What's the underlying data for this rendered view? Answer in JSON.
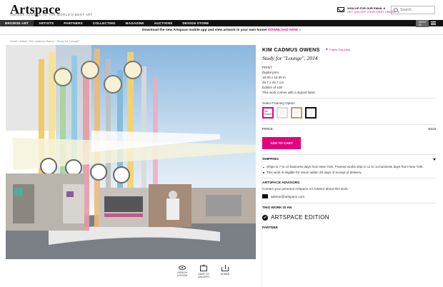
{
  "header": {
    "logo": "Artspace",
    "tagline": "INSIDER ACCESS TO THE WORLD'S BEST ART",
    "signup_line1": "SIGN UP FOR OUR EMAIL &",
    "signup_line2": "GET 10% OFF YOUR FIRST ORDER",
    "search_placeholder": "Search"
  },
  "nav": {
    "items": [
      {
        "label": "BROWSE ART"
      },
      {
        "label": "ARTISTS"
      },
      {
        "label": "PARTNERS"
      },
      {
        "label": "COLLECTING"
      },
      {
        "label": "MAGAZINE"
      },
      {
        "label": "AUCTIONS"
      },
      {
        "label": "DESIGN STORE"
      }
    ],
    "about_line1": "ABOUT",
    "about_line2": "US"
  },
  "promo": {
    "text": "Download the new Artspace mobile app and view artwork in your own home!",
    "link": "DOWNLOAD NOW »"
  },
  "breadcrumb": "Home / Artists / Kim Cadmus Owens / \"Study for 'Lounge'\"",
  "artwork_actions": [
    {
      "line1": "VIEW IN",
      "line2": "A ROOM"
    },
    {
      "line1": "SAVE TO",
      "line2": "GALLERY"
    },
    {
      "line1": "SHARE",
      "line2": ""
    }
  ],
  "product": {
    "artist": "KIM CADMUS OWENS",
    "follow": "Follow This Artist",
    "title": "Study for \"Lounge\", 2014",
    "type": "PRINT",
    "medium": "Digital print",
    "size_in": "18.00 x 18.00 in",
    "size_cm": "45.7 x 45.7 cm",
    "edition": "Edition of 100",
    "signed": "This work comes with a signed label.",
    "framing_label": "Select Framing Option",
    "no_frame": "No Frame",
    "price_label": "PRICE:",
    "price": "€415",
    "cart": "ADD TO CART"
  },
  "shipping": {
    "heading": "SHIPPING",
    "items": [
      "Ships in 7 to 10 business days from New York. Framed works ship in 11 to 14 business days from New York.",
      "This work is eligible for return within 30 days of receipt of delivery."
    ]
  },
  "advisors": {
    "heading": "ARTSPACE ADVISORS",
    "text": "Contact your personal Artspace Art Advisor about this work.",
    "email": "advisor@artspace.com"
  },
  "edition_block": {
    "heading": "THIS WORK IS AN",
    "brand": "ARTSPACE EDITION",
    "partner": "PARTNER"
  },
  "colors": {
    "accent": "#e4007e",
    "nav_bg": "#111111"
  }
}
